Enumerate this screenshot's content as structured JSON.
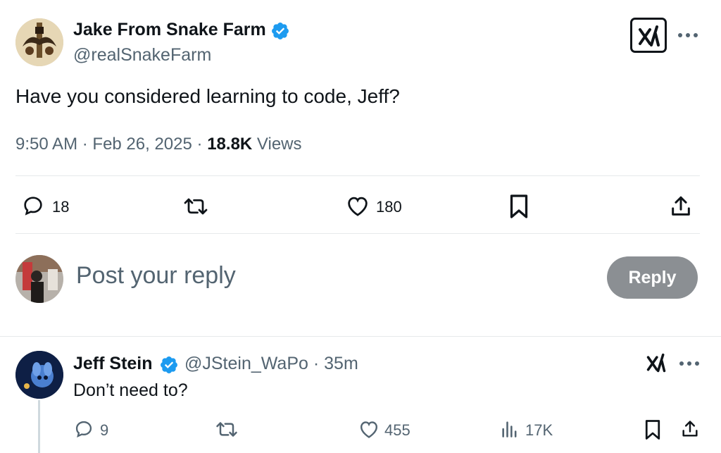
{
  "main_tweet": {
    "author_name": "Jake From Snake Farm",
    "author_handle": "@realSnakeFarm",
    "text": "Have you considered learning to code, Jeff?",
    "time": "9:50 AM",
    "date": "Feb 26, 2025",
    "views_count": "18.8K",
    "views_label": "Views",
    "replies": "18",
    "likes": "180"
  },
  "composer": {
    "placeholder": "Post your reply",
    "button_label": "Reply"
  },
  "reply_tweet": {
    "author_name": "Jeff Stein",
    "author_handle": "@JStein_WaPo",
    "age": "35m",
    "text": "Don’t need to?",
    "replies": "9",
    "likes": "455",
    "views": "17K"
  },
  "separators": {
    "dot": "·"
  },
  "colors": {
    "verified": "#1d9bf0",
    "muted": "#536471",
    "reply_button": "#8b8f93"
  }
}
